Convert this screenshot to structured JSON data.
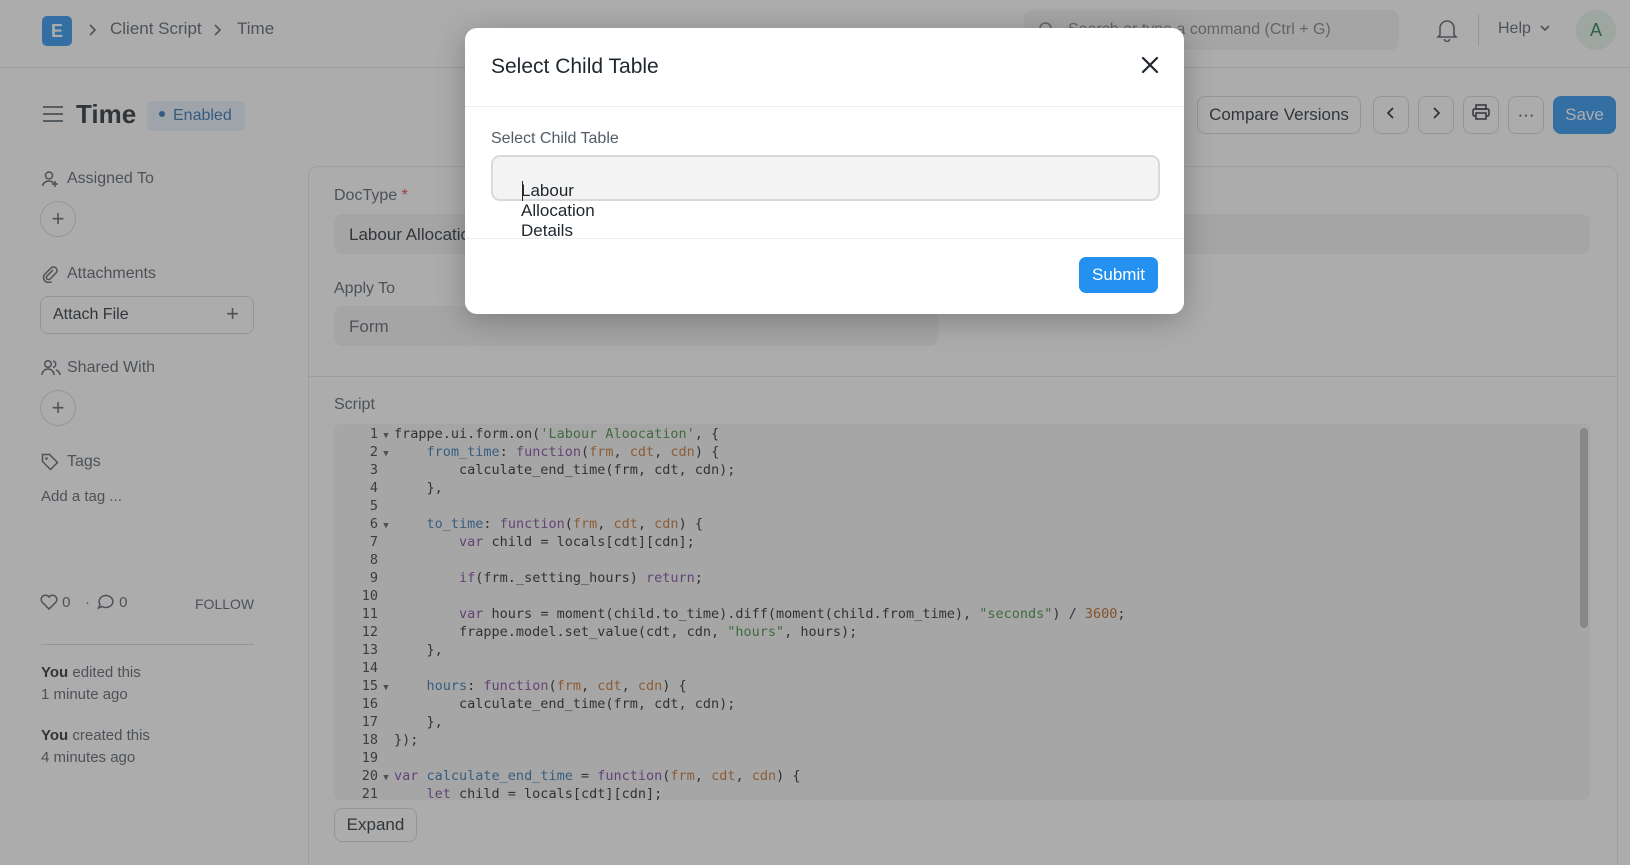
{
  "navbar": {
    "logo_letter": "E",
    "breadcrumbs": [
      "Client Script",
      "Time"
    ],
    "search_placeholder": "Search or type a command (Ctrl + G)",
    "help_label": "Help",
    "avatar_initial": "A"
  },
  "page": {
    "title": "Time",
    "status": "Enabled",
    "actions": {
      "compare_versions": "Compare Versions",
      "save": "Save"
    }
  },
  "sidebar": {
    "assigned_to": "Assigned To",
    "attachments": "Attachments",
    "attach_file": "Attach File",
    "shared_with": "Shared With",
    "tags": "Tags",
    "add_tag": "Add a tag ...",
    "likes": "0",
    "comments": "0",
    "follow": "FOLLOW",
    "activity": [
      {
        "actor": "You",
        "action": " edited this",
        "time": "1 minute ago"
      },
      {
        "actor": "You",
        "action": " created this",
        "time": "4 minutes ago"
      }
    ]
  },
  "form": {
    "doctype_label": "DocType",
    "required_mark": "*",
    "doctype_value": "Labour Allocation",
    "apply_to_label": "Apply To",
    "apply_to_value": "Form",
    "script_label": "Script",
    "expand_label": "Expand"
  },
  "modal": {
    "title": "Select Child Table",
    "field_label": "Select Child Table",
    "field_value": "Labour Allocation Details",
    "submit_label": "Submit"
  },
  "colors": {
    "primary": "#2490ef",
    "status_bg": "#e6f0fb",
    "status_text": "#2b6cb0"
  }
}
